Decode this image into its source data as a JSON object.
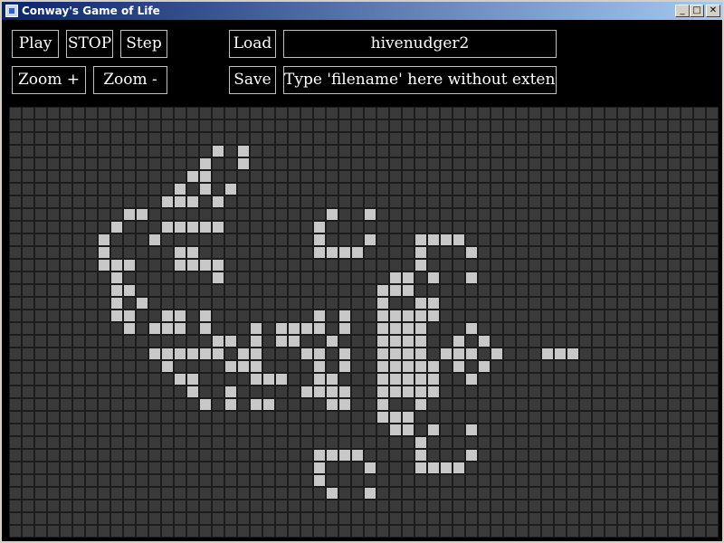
{
  "window": {
    "title": "Conway's Game of Life",
    "controls": {
      "minimize": "_",
      "maximize": "□",
      "close": "✕"
    }
  },
  "toolbar": {
    "play_label": "Play",
    "stop_label": "STOP",
    "step_label": "Step",
    "load_label": "Load",
    "zoom_in_label": "Zoom +",
    "zoom_out_label": "Zoom -",
    "save_label": "Save",
    "pattern_name": "hivenudger2",
    "filename_placeholder": "Type 'filename' here without extension"
  },
  "board": {
    "cols": 56,
    "rows": 34,
    "colors": {
      "background": "#1c1c1c",
      "dead": "#3a3a3a",
      "alive": "#c8c8c8"
    },
    "live_cells": [
      [
        16,
        3
      ],
      [
        18,
        3
      ],
      [
        15,
        4
      ],
      [
        18,
        4
      ],
      [
        14,
        5
      ],
      [
        15,
        5
      ],
      [
        13,
        6
      ],
      [
        15,
        6
      ],
      [
        17,
        6
      ],
      [
        12,
        7
      ],
      [
        13,
        7
      ],
      [
        14,
        7
      ],
      [
        16,
        7
      ],
      [
        9,
        8
      ],
      [
        10,
        8
      ],
      [
        25,
        8
      ],
      [
        28,
        8
      ],
      [
        8,
        9
      ],
      [
        12,
        9
      ],
      [
        13,
        9
      ],
      [
        14,
        9
      ],
      [
        15,
        9
      ],
      [
        16,
        9
      ],
      [
        24,
        9
      ],
      [
        7,
        10
      ],
      [
        11,
        10
      ],
      [
        24,
        10
      ],
      [
        28,
        10
      ],
      [
        32,
        10
      ],
      [
        33,
        10
      ],
      [
        34,
        10
      ],
      [
        35,
        10
      ],
      [
        7,
        11
      ],
      [
        13,
        11
      ],
      [
        14,
        11
      ],
      [
        24,
        11
      ],
      [
        25,
        11
      ],
      [
        26,
        11
      ],
      [
        27,
        11
      ],
      [
        32,
        11
      ],
      [
        36,
        11
      ],
      [
        7,
        12
      ],
      [
        8,
        12
      ],
      [
        9,
        12
      ],
      [
        13,
        12
      ],
      [
        14,
        12
      ],
      [
        15,
        12
      ],
      [
        16,
        12
      ],
      [
        32,
        12
      ],
      [
        8,
        13
      ],
      [
        16,
        13
      ],
      [
        30,
        13
      ],
      [
        31,
        13
      ],
      [
        33,
        13
      ],
      [
        36,
        13
      ],
      [
        8,
        14
      ],
      [
        9,
        14
      ],
      [
        29,
        14
      ],
      [
        30,
        14
      ],
      [
        31,
        14
      ],
      [
        8,
        15
      ],
      [
        10,
        15
      ],
      [
        29,
        15
      ],
      [
        32,
        15
      ],
      [
        33,
        15
      ],
      [
        8,
        16
      ],
      [
        9,
        16
      ],
      [
        12,
        16
      ],
      [
        13,
        16
      ],
      [
        15,
        16
      ],
      [
        24,
        16
      ],
      [
        26,
        16
      ],
      [
        29,
        16
      ],
      [
        30,
        16
      ],
      [
        31,
        16
      ],
      [
        32,
        16
      ],
      [
        33,
        16
      ],
      [
        9,
        17
      ],
      [
        11,
        17
      ],
      [
        12,
        17
      ],
      [
        13,
        17
      ],
      [
        15,
        17
      ],
      [
        19,
        17
      ],
      [
        21,
        17
      ],
      [
        22,
        17
      ],
      [
        23,
        17
      ],
      [
        24,
        17
      ],
      [
        26,
        17
      ],
      [
        29,
        17
      ],
      [
        30,
        17
      ],
      [
        31,
        17
      ],
      [
        32,
        17
      ],
      [
        36,
        17
      ],
      [
        16,
        18
      ],
      [
        17,
        18
      ],
      [
        19,
        18
      ],
      [
        21,
        18
      ],
      [
        22,
        18
      ],
      [
        25,
        18
      ],
      [
        29,
        18
      ],
      [
        30,
        18
      ],
      [
        31,
        18
      ],
      [
        32,
        18
      ],
      [
        35,
        18
      ],
      [
        37,
        18
      ],
      [
        11,
        19
      ],
      [
        12,
        19
      ],
      [
        13,
        19
      ],
      [
        14,
        19
      ],
      [
        15,
        19
      ],
      [
        16,
        19
      ],
      [
        18,
        19
      ],
      [
        19,
        19
      ],
      [
        23,
        19
      ],
      [
        24,
        19
      ],
      [
        26,
        19
      ],
      [
        29,
        19
      ],
      [
        30,
        19
      ],
      [
        31,
        19
      ],
      [
        32,
        19
      ],
      [
        34,
        19
      ],
      [
        35,
        19
      ],
      [
        36,
        19
      ],
      [
        38,
        19
      ],
      [
        42,
        19
      ],
      [
        43,
        19
      ],
      [
        44,
        19
      ],
      [
        12,
        20
      ],
      [
        17,
        20
      ],
      [
        18,
        20
      ],
      [
        19,
        20
      ],
      [
        24,
        20
      ],
      [
        26,
        20
      ],
      [
        29,
        20
      ],
      [
        30,
        20
      ],
      [
        31,
        20
      ],
      [
        32,
        20
      ],
      [
        33,
        20
      ],
      [
        35,
        20
      ],
      [
        37,
        20
      ],
      [
        13,
        21
      ],
      [
        14,
        21
      ],
      [
        19,
        21
      ],
      [
        20,
        21
      ],
      [
        21,
        21
      ],
      [
        24,
        21
      ],
      [
        25,
        21
      ],
      [
        29,
        21
      ],
      [
        30,
        21
      ],
      [
        31,
        21
      ],
      [
        32,
        21
      ],
      [
        33,
        21
      ],
      [
        36,
        21
      ],
      [
        14,
        22
      ],
      [
        17,
        22
      ],
      [
        23,
        22
      ],
      [
        24,
        22
      ],
      [
        25,
        22
      ],
      [
        26,
        22
      ],
      [
        29,
        22
      ],
      [
        30,
        22
      ],
      [
        31,
        22
      ],
      [
        32,
        22
      ],
      [
        33,
        22
      ],
      [
        15,
        23
      ],
      [
        17,
        23
      ],
      [
        19,
        23
      ],
      [
        20,
        23
      ],
      [
        25,
        23
      ],
      [
        26,
        23
      ],
      [
        29,
        23
      ],
      [
        32,
        23
      ],
      [
        29,
        24
      ],
      [
        30,
        24
      ],
      [
        31,
        24
      ],
      [
        30,
        25
      ],
      [
        31,
        25
      ],
      [
        33,
        25
      ],
      [
        36,
        25
      ],
      [
        32,
        26
      ],
      [
        24,
        27
      ],
      [
        25,
        27
      ],
      [
        26,
        27
      ],
      [
        27,
        27
      ],
      [
        32,
        27
      ],
      [
        36,
        27
      ],
      [
        24,
        28
      ],
      [
        28,
        28
      ],
      [
        32,
        28
      ],
      [
        33,
        28
      ],
      [
        34,
        28
      ],
      [
        35,
        28
      ],
      [
        24,
        29
      ],
      [
        25,
        30
      ],
      [
        28,
        30
      ]
    ]
  }
}
